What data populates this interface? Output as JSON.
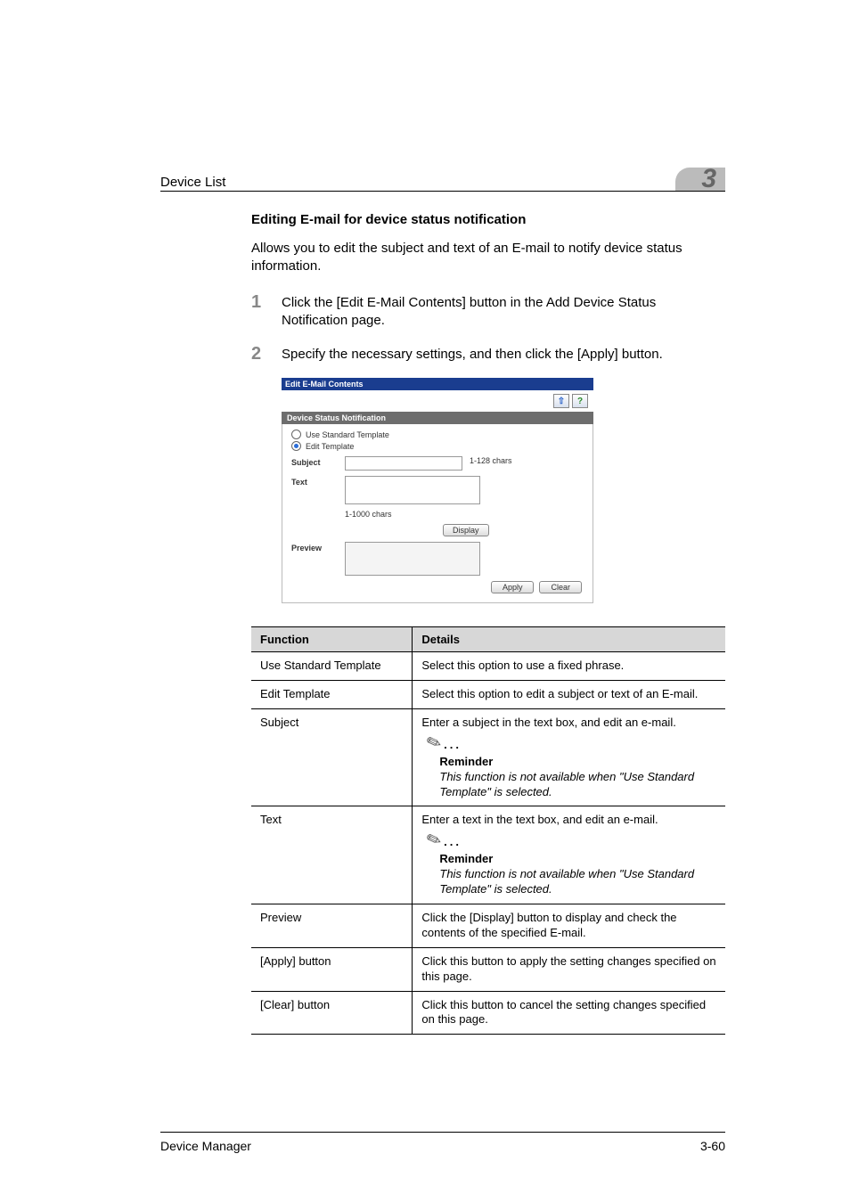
{
  "header": {
    "running_title": "Device List",
    "chapter_number": "3"
  },
  "section": {
    "heading": "Editing E-mail for device status notification",
    "intro": "Allows you to edit the subject and text of an E-mail to notify device status information."
  },
  "steps": {
    "s1_num": "1",
    "s1_text": "Click the [Edit E-Mail Contents] button in the Add Device Status Notification page.",
    "s2_num": "2",
    "s2_text": "Specify the necessary settings, and then click the [Apply] button."
  },
  "screenshot": {
    "window_title": "Edit E-Mail Contents",
    "icon_back": "⇧",
    "icon_help": "?",
    "section_bar": "Device Status Notification",
    "opt_use_std": "Use Standard Template",
    "opt_edit_tpl": "Edit Template",
    "lbl_subject": "Subject",
    "hint_subject": "1-128 chars",
    "lbl_text": "Text",
    "hint_text": "1-1000 chars",
    "btn_display": "Display",
    "lbl_preview": "Preview",
    "btn_apply": "Apply",
    "btn_clear": "Clear"
  },
  "table": {
    "head_function": "Function",
    "head_details": "Details",
    "rows": {
      "use_std": {
        "f": "Use Standard Template",
        "d": "Select this option to use a fixed phrase."
      },
      "edit_tpl": {
        "f": "Edit Template",
        "d": "Select this option to edit a subject or text of an E-mail."
      },
      "subject": {
        "f": "Subject",
        "d": "Enter a subject in the text box, and edit an e-mail.",
        "rem_head": "Reminder",
        "rem_body": "This function is not available when \"Use Standard Template\" is selected."
      },
      "text": {
        "f": "Text",
        "d": "Enter a text in the text box, and edit an e-mail.",
        "rem_head": "Reminder",
        "rem_body": "This function is not available when \"Use Standard Template\" is selected."
      },
      "preview": {
        "f": "Preview",
        "d": "Click the [Display] button to display and check the contents of the specified E-mail."
      },
      "apply": {
        "f": "[Apply] button",
        "d": "Click this button to apply the setting changes specified on this page."
      },
      "clear": {
        "f": "[Clear] button",
        "d": "Click this button to cancel the setting changes specified on this page."
      }
    }
  },
  "footer": {
    "left": "Device Manager",
    "right": "3-60"
  },
  "glyphs": {
    "dots": "..."
  }
}
